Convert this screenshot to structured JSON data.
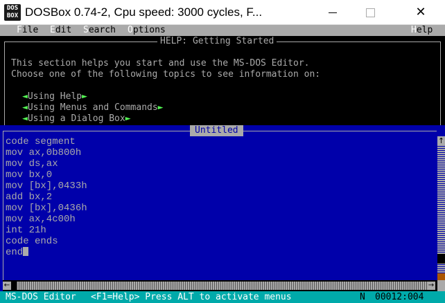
{
  "window": {
    "icon_text": "DOS\nBOX",
    "title": "DOSBox 0.74-2, Cpu speed:     3000 cycles, F..."
  },
  "menubar": {
    "items": [
      {
        "hot": "F",
        "rest": "ile"
      },
      {
        "hot": "E",
        "rest": "dit"
      },
      {
        "hot": "S",
        "rest": "earch"
      },
      {
        "hot": "O",
        "rest": "ptions"
      },
      {
        "hot": "H",
        "rest": "elp"
      }
    ]
  },
  "help": {
    "title": "HELP: Getting Started",
    "intro_line1": "This section helps you start and use the MS-DOS Editor.",
    "intro_line2": "Choose one of the following topics to see information on:",
    "links": [
      {
        "label": "Using Help"
      },
      {
        "label": "Using Menus and Commands"
      },
      {
        "label": "Using a Dialog Box"
      }
    ],
    "arrow_left": "◄",
    "arrow_right": "►"
  },
  "editor": {
    "title": "Untitled",
    "lines": [
      "code segment",
      "mov ax,0b800h",
      "mov ds,ax",
      "mov bx,0",
      "mov [bx],0433h",
      "add bx,2",
      "mov [bx],0436h",
      "mov ax,4c00h",
      "int 21h",
      "code ends",
      "end"
    ],
    "scroll_up": "↑",
    "scroll_down": "↓",
    "scroll_left": "←",
    "scroll_right": "→"
  },
  "status": {
    "app": "MS-DOS Editor",
    "hint": "<F1=Help> Press ALT to activate menus",
    "mode": "N",
    "position": "00012:004"
  },
  "colors": {
    "menubar": "#aaaaaa",
    "editor_bg": "#0000aa",
    "status_bg": "#00aaaa",
    "link_arrow": "#55ff55"
  }
}
